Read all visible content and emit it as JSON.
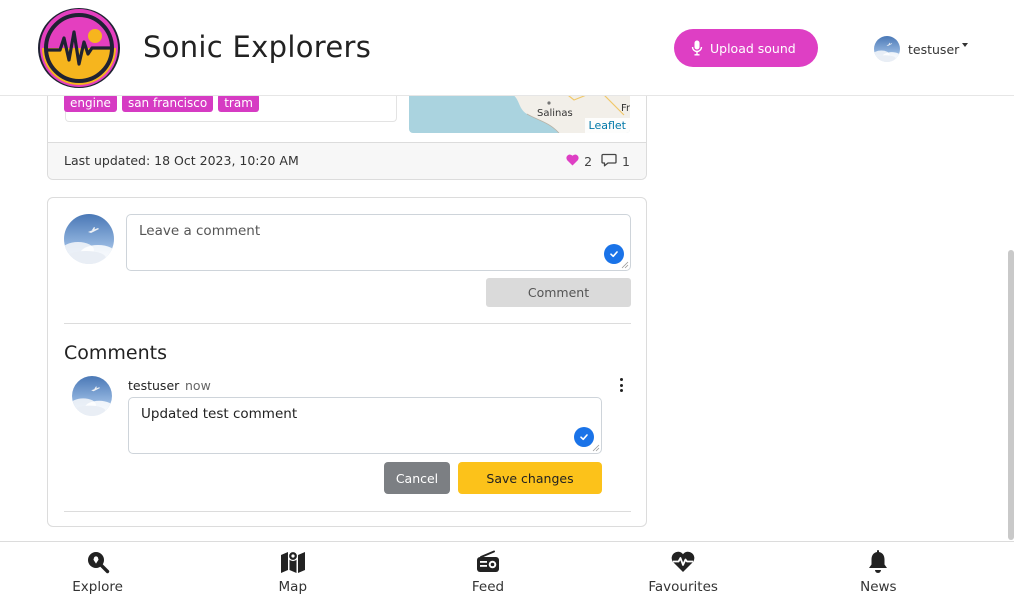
{
  "app": {
    "title": "Sonic Explorers"
  },
  "header": {
    "upload_label": "Upload sound",
    "username": "testuser"
  },
  "sound": {
    "tags": [
      "engine",
      "san francisco",
      "tram"
    ],
    "map": {
      "city_label": "Salinas",
      "edge_label": "Fr",
      "attribution": "Leaflet"
    },
    "last_updated": "Last updated: 18 Oct 2023, 10:20 AM",
    "likes": "2",
    "comments_count": "1"
  },
  "comment_form": {
    "placeholder": "Leave a comment",
    "submit_label": "Comment"
  },
  "comments": {
    "title": "Comments",
    "items": [
      {
        "author": "testuser",
        "time": "now",
        "text": "Updated test comment"
      }
    ],
    "cancel_label": "Cancel",
    "save_label": "Save changes"
  },
  "nav": [
    {
      "label": "Explore",
      "icon": "search-location-icon"
    },
    {
      "label": "Map",
      "icon": "map-icon"
    },
    {
      "label": "Feed",
      "icon": "radio-icon"
    },
    {
      "label": "Favourites",
      "icon": "heart-pulse-icon"
    },
    {
      "label": "News",
      "icon": "bell-icon"
    }
  ],
  "colors": {
    "accent": "#de3fc4",
    "tag": "#d63bc3",
    "save": "#fcc21a",
    "check": "#1a73e8"
  }
}
